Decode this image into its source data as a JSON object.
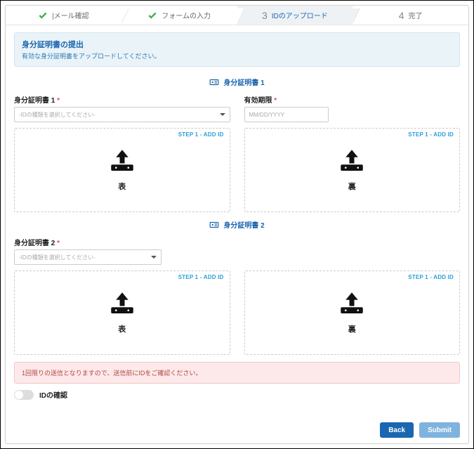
{
  "stepper": {
    "steps": [
      {
        "label": "|メール確認",
        "state": "done"
      },
      {
        "label": "フォームの入力",
        "state": "done"
      },
      {
        "num": "3",
        "label": "IDのアップロード",
        "state": "active"
      },
      {
        "num": "4",
        "label": "完了",
        "state": "pending"
      }
    ]
  },
  "notice": {
    "title": "身分証明書の提出",
    "subtitle": "有効な身分証明書をアップロードしてください。"
  },
  "section1": {
    "title": "身分証明書 1",
    "field_id_label": "身分証明書 1",
    "field_id_placeholder": "-IDの種類を選択してください-",
    "field_expiry_label": "有効期限",
    "field_expiry_placeholder": "MM/DD/YYYY",
    "upload_label": "STEP 1 - ADD ID",
    "front": "表",
    "back": "裏"
  },
  "section2": {
    "title": "身分証明書 2",
    "field_id_label": "身分証明書 2",
    "field_id_placeholder": "-IDの種類を選択してください-",
    "upload_label": "STEP 1 - ADD ID",
    "front": "表",
    "back": "裏"
  },
  "warning": "1回限りの送信となりますので、送信前にIDをご確認ください。",
  "confirm_label": "IDの確認",
  "buttons": {
    "back": "Back",
    "submit": "Submit"
  }
}
